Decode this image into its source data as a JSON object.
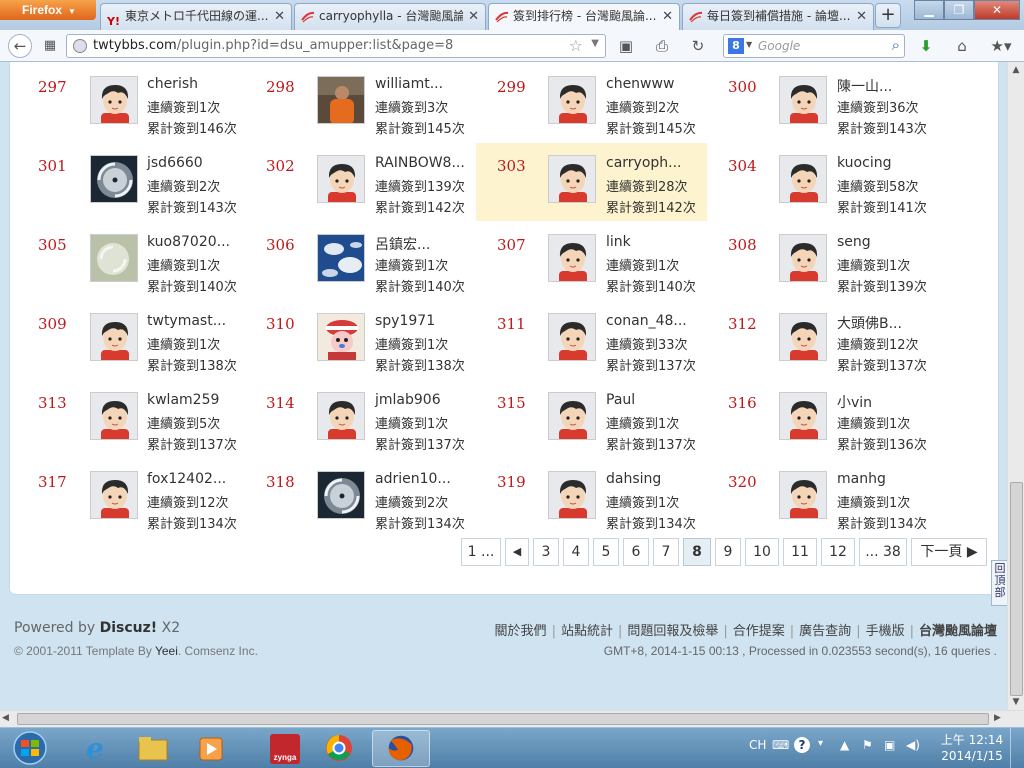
{
  "browser": {
    "app_button": "Firefox",
    "tabs": [
      {
        "label": "東京メトロ千代田線の運..."
      },
      {
        "label": "carryophylla - 台灣颱風論..."
      },
      {
        "label": "簽到排行榜 - 台灣颱風論..."
      },
      {
        "label": "每日簽到補償措施 - 論壇..."
      }
    ],
    "new_tab": "+",
    "url_host": "twtybbs.com",
    "url_path": "/plugin.php?id=dsu_amupper:list&page=8",
    "search_placeholder": "Google",
    "search_engine": "8"
  },
  "ranking": {
    "rows": [
      [
        {
          "rank": "297",
          "name": "cherish",
          "streak": "連續簽到1次",
          "total": "累計簽到146次",
          "avatar": "default"
        },
        {
          "rank": "298",
          "name": "williamt...",
          "streak": "連續簽到3次",
          "total": "累計簽到145次",
          "avatar": "photo"
        },
        {
          "rank": "299",
          "name": "chenwww",
          "streak": "連續簽到2次",
          "total": "累計簽到145次",
          "avatar": "default"
        },
        {
          "rank": "300",
          "name": "陳一山...",
          "streak": "連續簽到36次",
          "total": "累計簽到143次",
          "avatar": "default"
        }
      ],
      [
        {
          "rank": "301",
          "name": "jsd6660",
          "streak": "連續簽到2次",
          "total": "累計簽到143次",
          "avatar": "typhoon"
        },
        {
          "rank": "302",
          "name": "RAINBOW8...",
          "streak": "連續簽到139次",
          "total": "累計簽到142次",
          "avatar": "default"
        },
        {
          "rank": "303",
          "name": "carryoph...",
          "streak": "連續簽到28次",
          "total": "累計簽到142次",
          "avatar": "default",
          "highlight": true
        },
        {
          "rank": "304",
          "name": "kuocing",
          "streak": "連續簽到58次",
          "total": "累計簽到141次",
          "avatar": "default"
        }
      ],
      [
        {
          "rank": "305",
          "name": "kuo87020...",
          "streak": "連續簽到1次",
          "total": "累計簽到140次",
          "avatar": "typhoon-light"
        },
        {
          "rank": "306",
          "name": "呂鎮宏...",
          "streak": "連續簽到1次",
          "total": "累計簽到140次",
          "avatar": "satellite"
        },
        {
          "rank": "307",
          "name": "link",
          "streak": "連續簽到1次",
          "total": "累計簽到140次",
          "avatar": "default"
        },
        {
          "rank": "308",
          "name": "seng",
          "streak": "連續簽到1次",
          "total": "累計簽到139次",
          "avatar": "default"
        }
      ],
      [
        {
          "rank": "309",
          "name": "twtymast...",
          "streak": "連續簽到1次",
          "total": "累計簽到138次",
          "avatar": "default"
        },
        {
          "rank": "310",
          "name": "spy1971",
          "streak": "連續簽到1次",
          "total": "累計簽到138次",
          "avatar": "cartoon"
        },
        {
          "rank": "311",
          "name": "conan_48...",
          "streak": "連續簽到33次",
          "total": "累計簽到137次",
          "avatar": "default"
        },
        {
          "rank": "312",
          "name": "大頭佛B...",
          "streak": "連續簽到12次",
          "total": "累計簽到137次",
          "avatar": "default"
        }
      ],
      [
        {
          "rank": "313",
          "name": "kwlam259",
          "streak": "連續簽到5次",
          "total": "累計簽到137次",
          "avatar": "default"
        },
        {
          "rank": "314",
          "name": "jmlab906",
          "streak": "連續簽到1次",
          "total": "累計簽到137次",
          "avatar": "default"
        },
        {
          "rank": "315",
          "name": "Paul",
          "streak": "連續簽到1次",
          "total": "累計簽到137次",
          "avatar": "default"
        },
        {
          "rank": "316",
          "name": "小vin",
          "streak": "連續簽到1次",
          "total": "累計簽到136次",
          "avatar": "default"
        }
      ],
      [
        {
          "rank": "317",
          "name": "fox12402...",
          "streak": "連續簽到12次",
          "total": "累計簽到134次",
          "avatar": "default"
        },
        {
          "rank": "318",
          "name": "adrien10...",
          "streak": "連續簽到2次",
          "total": "累計簽到134次",
          "avatar": "typhoon"
        },
        {
          "rank": "319",
          "name": "dahsing",
          "streak": "連續簽到1次",
          "total": "累計簽到134次",
          "avatar": "default"
        },
        {
          "rank": "320",
          "name": "manhg",
          "streak": "連續簽到1次",
          "total": "累計簽到134次",
          "avatar": "default"
        }
      ]
    ]
  },
  "pagination": {
    "first": "1 ...",
    "prev": "◀",
    "pages": [
      "3",
      "4",
      "5",
      "6",
      "7",
      "8",
      "9",
      "10",
      "11",
      "12"
    ],
    "current": "8",
    "last": "... 38",
    "next": "下一頁 ▶"
  },
  "back_to_top": "回頂部",
  "footer": {
    "powered_prefix": "Powered by",
    "powered_brand": "Discuz!",
    "powered_version": "X2",
    "copyright_prefix": "© 2001-2011 Template By",
    "copyright_author": "Yeei",
    "copyright_suffix": ". Comsenz Inc.",
    "links": [
      "關於我們",
      "站點統計",
      "問題回報及檢舉",
      "合作提案",
      "廣告查詢",
      "手機版",
      "台灣颱風論壇"
    ],
    "stats": "GMT+8, 2014-1-15 00:13 , Processed in 0.023553 second(s), 16 queries ."
  },
  "taskbar": {
    "lang": "CH",
    "time": "上午 12:14",
    "date": "2014/1/15"
  },
  "colors": {
    "rank": "#c0171b",
    "highlight": "#fdf4cf",
    "page_bg": "#cfe3f1"
  }
}
